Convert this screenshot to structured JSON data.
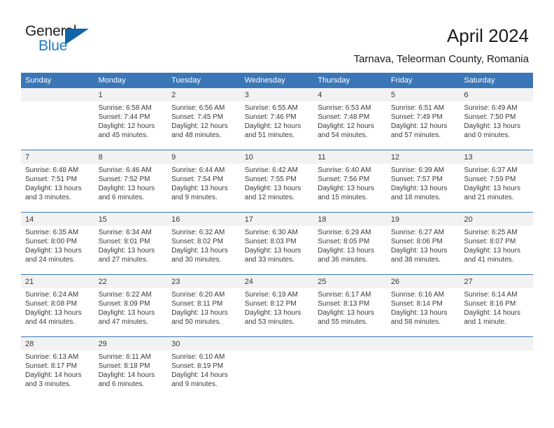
{
  "logo": {
    "word_top": "General",
    "word_bottom": "Blue",
    "triangle_color": "#1263a8",
    "blue_color": "#1f7ac4"
  },
  "header": {
    "title": "April 2024",
    "subtitle": "Tarnava, Teleorman County, Romania"
  },
  "theme": {
    "header_blue": "#3b77b7",
    "date_band_gray": "#f2f2f2",
    "text_color": "#3a3a3a"
  },
  "calendar": {
    "weekday_headers": [
      "Sunday",
      "Monday",
      "Tuesday",
      "Wednesday",
      "Thursday",
      "Friday",
      "Saturday"
    ],
    "weeks": [
      {
        "dates": [
          "",
          "1",
          "2",
          "3",
          "4",
          "5",
          "6"
        ],
        "cells": [
          {
            "sunrise": "",
            "sunset": "",
            "daylight1": "",
            "daylight2": ""
          },
          {
            "sunrise": "Sunrise: 6:58 AM",
            "sunset": "Sunset: 7:44 PM",
            "daylight1": "Daylight: 12 hours",
            "daylight2": "and 45 minutes."
          },
          {
            "sunrise": "Sunrise: 6:56 AM",
            "sunset": "Sunset: 7:45 PM",
            "daylight1": "Daylight: 12 hours",
            "daylight2": "and 48 minutes."
          },
          {
            "sunrise": "Sunrise: 6:55 AM",
            "sunset": "Sunset: 7:46 PM",
            "daylight1": "Daylight: 12 hours",
            "daylight2": "and 51 minutes."
          },
          {
            "sunrise": "Sunrise: 6:53 AM",
            "sunset": "Sunset: 7:48 PM",
            "daylight1": "Daylight: 12 hours",
            "daylight2": "and 54 minutes."
          },
          {
            "sunrise": "Sunrise: 6:51 AM",
            "sunset": "Sunset: 7:49 PM",
            "daylight1": "Daylight: 12 hours",
            "daylight2": "and 57 minutes."
          },
          {
            "sunrise": "Sunrise: 6:49 AM",
            "sunset": "Sunset: 7:50 PM",
            "daylight1": "Daylight: 13 hours",
            "daylight2": "and 0 minutes."
          }
        ]
      },
      {
        "dates": [
          "7",
          "8",
          "9",
          "10",
          "11",
          "12",
          "13"
        ],
        "cells": [
          {
            "sunrise": "Sunrise: 6:48 AM",
            "sunset": "Sunset: 7:51 PM",
            "daylight1": "Daylight: 13 hours",
            "daylight2": "and 3 minutes."
          },
          {
            "sunrise": "Sunrise: 6:46 AM",
            "sunset": "Sunset: 7:52 PM",
            "daylight1": "Daylight: 13 hours",
            "daylight2": "and 6 minutes."
          },
          {
            "sunrise": "Sunrise: 6:44 AM",
            "sunset": "Sunset: 7:54 PM",
            "daylight1": "Daylight: 13 hours",
            "daylight2": "and 9 minutes."
          },
          {
            "sunrise": "Sunrise: 6:42 AM",
            "sunset": "Sunset: 7:55 PM",
            "daylight1": "Daylight: 13 hours",
            "daylight2": "and 12 minutes."
          },
          {
            "sunrise": "Sunrise: 6:40 AM",
            "sunset": "Sunset: 7:56 PM",
            "daylight1": "Daylight: 13 hours",
            "daylight2": "and 15 minutes."
          },
          {
            "sunrise": "Sunrise: 6:39 AM",
            "sunset": "Sunset: 7:57 PM",
            "daylight1": "Daylight: 13 hours",
            "daylight2": "and 18 minutes."
          },
          {
            "sunrise": "Sunrise: 6:37 AM",
            "sunset": "Sunset: 7:59 PM",
            "daylight1": "Daylight: 13 hours",
            "daylight2": "and 21 minutes."
          }
        ]
      },
      {
        "dates": [
          "14",
          "15",
          "16",
          "17",
          "18",
          "19",
          "20"
        ],
        "cells": [
          {
            "sunrise": "Sunrise: 6:35 AM",
            "sunset": "Sunset: 8:00 PM",
            "daylight1": "Daylight: 13 hours",
            "daylight2": "and 24 minutes."
          },
          {
            "sunrise": "Sunrise: 6:34 AM",
            "sunset": "Sunset: 8:01 PM",
            "daylight1": "Daylight: 13 hours",
            "daylight2": "and 27 minutes."
          },
          {
            "sunrise": "Sunrise: 6:32 AM",
            "sunset": "Sunset: 8:02 PM",
            "daylight1": "Daylight: 13 hours",
            "daylight2": "and 30 minutes."
          },
          {
            "sunrise": "Sunrise: 6:30 AM",
            "sunset": "Sunset: 8:03 PM",
            "daylight1": "Daylight: 13 hours",
            "daylight2": "and 33 minutes."
          },
          {
            "sunrise": "Sunrise: 6:29 AM",
            "sunset": "Sunset: 8:05 PM",
            "daylight1": "Daylight: 13 hours",
            "daylight2": "and 36 minutes."
          },
          {
            "sunrise": "Sunrise: 6:27 AM",
            "sunset": "Sunset: 8:06 PM",
            "daylight1": "Daylight: 13 hours",
            "daylight2": "and 38 minutes."
          },
          {
            "sunrise": "Sunrise: 6:25 AM",
            "sunset": "Sunset: 8:07 PM",
            "daylight1": "Daylight: 13 hours",
            "daylight2": "and 41 minutes."
          }
        ]
      },
      {
        "dates": [
          "21",
          "22",
          "23",
          "24",
          "25",
          "26",
          "27"
        ],
        "cells": [
          {
            "sunrise": "Sunrise: 6:24 AM",
            "sunset": "Sunset: 8:08 PM",
            "daylight1": "Daylight: 13 hours",
            "daylight2": "and 44 minutes."
          },
          {
            "sunrise": "Sunrise: 6:22 AM",
            "sunset": "Sunset: 8:09 PM",
            "daylight1": "Daylight: 13 hours",
            "daylight2": "and 47 minutes."
          },
          {
            "sunrise": "Sunrise: 6:20 AM",
            "sunset": "Sunset: 8:11 PM",
            "daylight1": "Daylight: 13 hours",
            "daylight2": "and 50 minutes."
          },
          {
            "sunrise": "Sunrise: 6:19 AM",
            "sunset": "Sunset: 8:12 PM",
            "daylight1": "Daylight: 13 hours",
            "daylight2": "and 53 minutes."
          },
          {
            "sunrise": "Sunrise: 6:17 AM",
            "sunset": "Sunset: 8:13 PM",
            "daylight1": "Daylight: 13 hours",
            "daylight2": "and 55 minutes."
          },
          {
            "sunrise": "Sunrise: 6:16 AM",
            "sunset": "Sunset: 8:14 PM",
            "daylight1": "Daylight: 13 hours",
            "daylight2": "and 58 minutes."
          },
          {
            "sunrise": "Sunrise: 6:14 AM",
            "sunset": "Sunset: 8:16 PM",
            "daylight1": "Daylight: 14 hours",
            "daylight2": "and 1 minute."
          }
        ]
      },
      {
        "dates": [
          "28",
          "29",
          "30",
          "",
          "",
          "",
          ""
        ],
        "cells": [
          {
            "sunrise": "Sunrise: 6:13 AM",
            "sunset": "Sunset: 8:17 PM",
            "daylight1": "Daylight: 14 hours",
            "daylight2": "and 3 minutes."
          },
          {
            "sunrise": "Sunrise: 6:11 AM",
            "sunset": "Sunset: 8:18 PM",
            "daylight1": "Daylight: 14 hours",
            "daylight2": "and 6 minutes."
          },
          {
            "sunrise": "Sunrise: 6:10 AM",
            "sunset": "Sunset: 8:19 PM",
            "daylight1": "Daylight: 14 hours",
            "daylight2": "and 9 minutes."
          },
          {
            "sunrise": "",
            "sunset": "",
            "daylight1": "",
            "daylight2": ""
          },
          {
            "sunrise": "",
            "sunset": "",
            "daylight1": "",
            "daylight2": ""
          },
          {
            "sunrise": "",
            "sunset": "",
            "daylight1": "",
            "daylight2": ""
          },
          {
            "sunrise": "",
            "sunset": "",
            "daylight1": "",
            "daylight2": ""
          }
        ]
      }
    ]
  }
}
